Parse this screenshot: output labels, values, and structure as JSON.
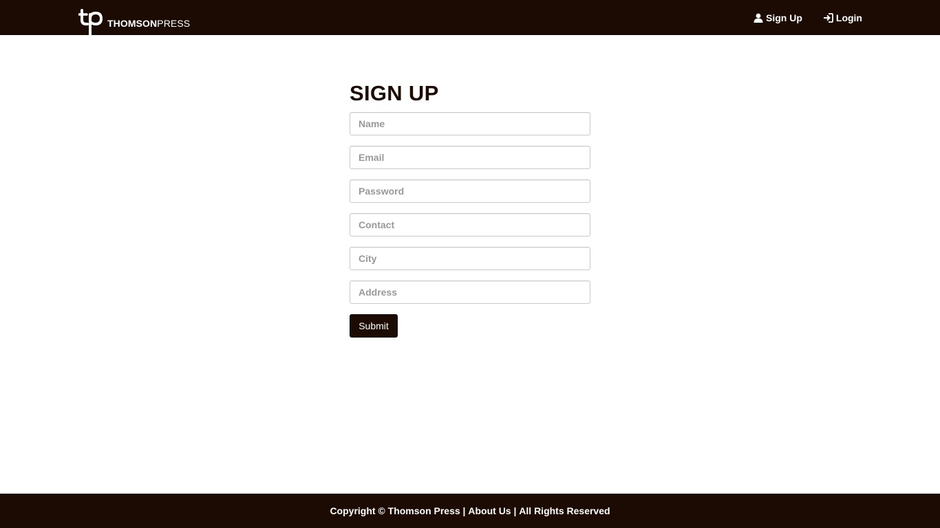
{
  "colors": {
    "primary_dark": "#1b0b03",
    "page_background": "#ffffff",
    "input_border": "#c9c9c9",
    "placeholder": "#999999"
  },
  "navbar": {
    "brand": {
      "logo_icon": "tp-logo",
      "name_bold": "THOMSON",
      "name_light": "PRESS"
    },
    "links": [
      {
        "icon": "user-icon",
        "label": "Sign Up"
      },
      {
        "icon": "login-icon",
        "label": "Login"
      }
    ]
  },
  "form": {
    "title": "SIGN UP",
    "fields": [
      {
        "placeholder": "Name",
        "value": ""
      },
      {
        "placeholder": "Email",
        "value": ""
      },
      {
        "placeholder": "Password",
        "value": ""
      },
      {
        "placeholder": "Contact",
        "value": ""
      },
      {
        "placeholder": "City",
        "value": ""
      },
      {
        "placeholder": "Address",
        "value": ""
      }
    ],
    "submit_label": "Submit"
  },
  "footer": {
    "copyright": "Copyright © Thomson Press",
    "separator": " | ",
    "about": "About Us",
    "rights": "All Rights Reserved"
  }
}
